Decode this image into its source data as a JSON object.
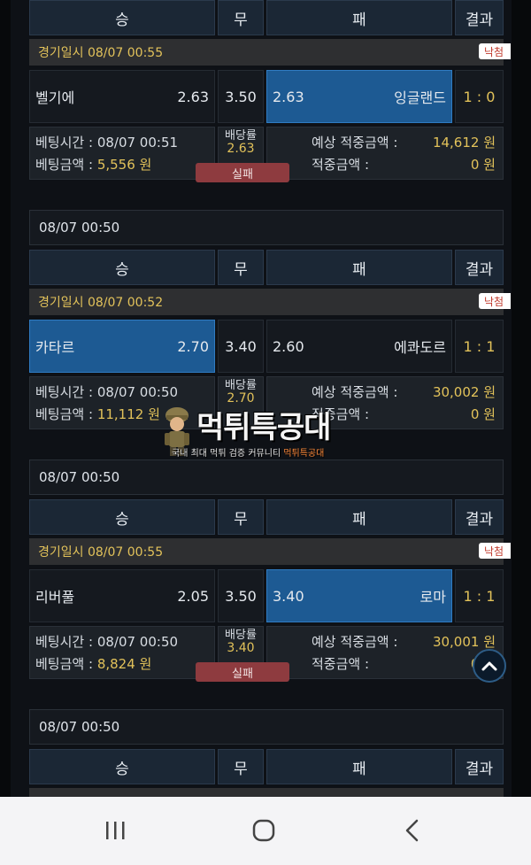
{
  "headers": {
    "win": "승",
    "draw": "무",
    "lose": "패",
    "result": "결과"
  },
  "labels": {
    "game_date_prefix": "경기일시",
    "bet_time": "베팅시간 :",
    "bet_amount": "베팅금액 :",
    "odds": "배당률",
    "expected_win": "예상 적중금액 :",
    "win_amount": "적중금액 :"
  },
  "bets": [
    {
      "game_date": "경기일시 08/07 00:55",
      "status_badge": "낙첨",
      "home": "벨기에",
      "home_odds": "2.63",
      "draw_odds": "3.50",
      "away": "잉글랜드",
      "away_odds": "2.63",
      "selected": "away",
      "score": "1 : 0",
      "bet_time": "08/07 00:51",
      "bet_amount": "5,556 원",
      "odds": "2.63",
      "expected": "14,612 원",
      "won": "0 원",
      "result_tag": "실패"
    },
    {
      "date_header": "08/07 00:50",
      "game_date": "경기일시 08/07 00:52",
      "status_badge": "낙첨",
      "home": "카타르",
      "home_odds": "2.70",
      "draw_odds": "3.40",
      "away": "에콰도르",
      "away_odds": "2.60",
      "selected": "home",
      "score": "1 : 1",
      "bet_time": "08/07 00:50",
      "bet_amount": "11,112 원",
      "odds": "2.70",
      "expected": "30,002 원",
      "won": "0 원"
    },
    {
      "date_header": "08/07 00:50",
      "game_date": "경기일시 08/07 00:55",
      "status_badge": "낙첨",
      "home": "리버풀",
      "home_odds": "2.05",
      "draw_odds": "3.50",
      "away": "로마",
      "away_odds": "3.40",
      "selected": "away",
      "score": "1 : 1",
      "bet_time": "08/07 00:50",
      "bet_amount": "8,824 원",
      "odds": "3.40",
      "expected": "30,001 원",
      "won": "0 원",
      "result_tag": "실패"
    },
    {
      "date_header": "08/07 00:50"
    }
  ],
  "watermark": {
    "title": "먹튀특공대",
    "subtitle_a": "국내 최대 먹튀 검증 커뮤니티",
    "subtitle_b": "먹튀특공대"
  },
  "colors": {
    "selected": "#1d5a93",
    "accent_yellow": "#e2c25a",
    "fail": "#8e3b3f"
  }
}
